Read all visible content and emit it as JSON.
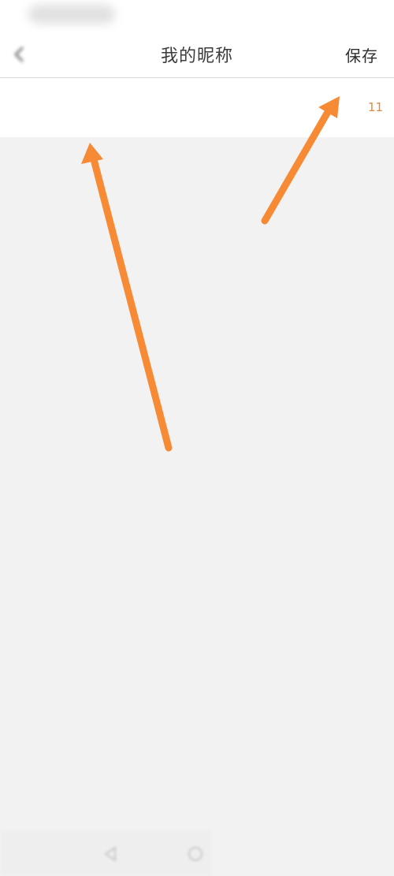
{
  "status_bar": {},
  "header": {
    "title": "我的昵称",
    "save_label": "保存"
  },
  "nickname": {
    "value": "",
    "count": "11"
  },
  "annotation": {
    "arrow_color": "#f78a35"
  },
  "colors": {
    "accent": "#e8873a",
    "background": "#f3f2f3"
  }
}
